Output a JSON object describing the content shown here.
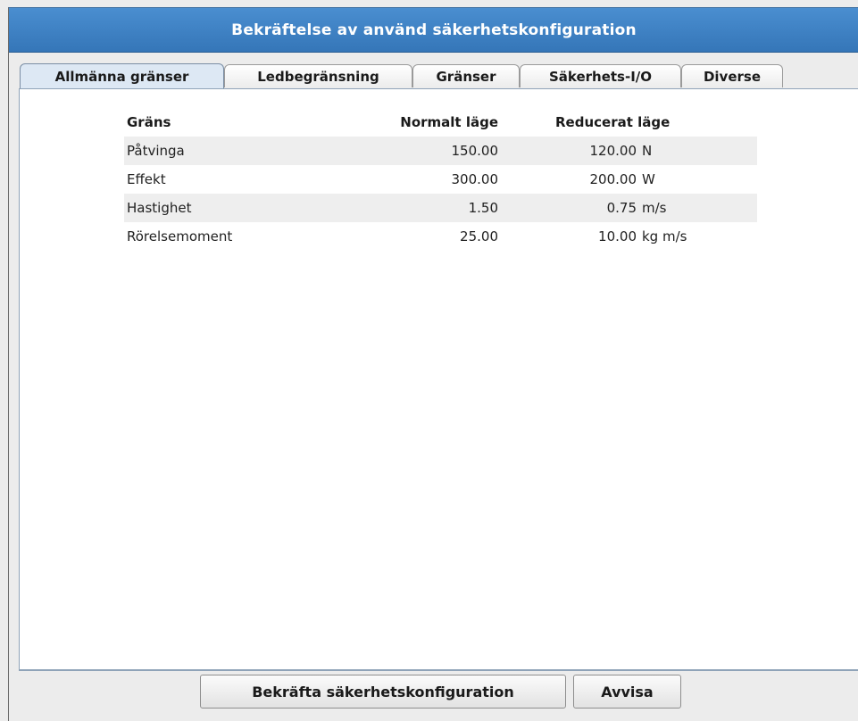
{
  "dialog": {
    "title": "Bekräftelse av använd säkerhetskonfiguration"
  },
  "tabs": [
    {
      "label": "Allmänna gränser",
      "active": true
    },
    {
      "label": "Ledbegränsning",
      "active": false
    },
    {
      "label": "Gränser",
      "active": false
    },
    {
      "label": "Säkerhets-I/O",
      "active": false
    },
    {
      "label": "Diverse",
      "active": false
    }
  ],
  "table": {
    "headers": {
      "name": "Gräns",
      "normal": "Normalt läge",
      "reduced": "Reducerat läge"
    },
    "rows": [
      {
        "name": "Påtvinga",
        "normal": "150.00",
        "reduced": "120.00",
        "unit": "N"
      },
      {
        "name": "Effekt",
        "normal": "300.00",
        "reduced": "200.00",
        "unit": "W"
      },
      {
        "name": "Hastighet",
        "normal": "1.50",
        "reduced": "0.75",
        "unit": "m/s"
      },
      {
        "name": "Rörelsemoment",
        "normal": "25.00",
        "reduced": "10.00",
        "unit": "kg m/s"
      }
    ]
  },
  "buttons": {
    "confirm": "Bekräfta säkerhetskonfiguration",
    "reject": "Avvisa"
  },
  "colors": {
    "titlebar": "#3a7fc2",
    "active_tab": "#dde8f4",
    "row_shade": "#eeeeee"
  }
}
